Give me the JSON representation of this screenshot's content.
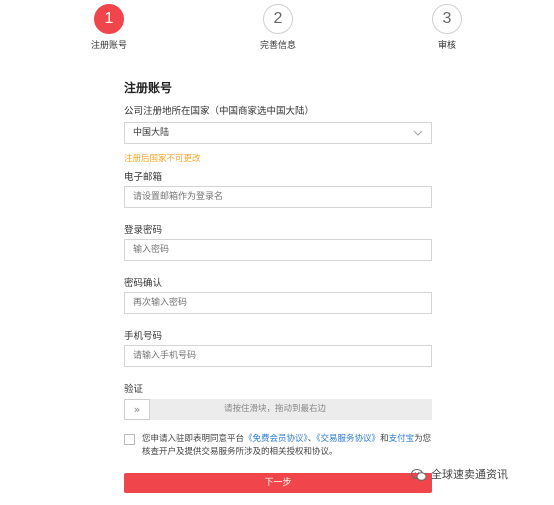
{
  "steps": [
    {
      "number": "1",
      "label": "注册账号"
    },
    {
      "number": "2",
      "label": "完善信息"
    },
    {
      "number": "3",
      "label": "审核"
    }
  ],
  "form": {
    "heading": "注册账号",
    "country_label": "公司注册地所在国家（中国商家选中国大陆）",
    "country_value": "中国大陆",
    "country_note": "注册后国家不可更改",
    "email_label": "电子邮箱",
    "email_placeholder": "请设置邮箱作为登录名",
    "password_label": "登录密码",
    "password_placeholder": "输入密码",
    "confirm_label": "密码确认",
    "confirm_placeholder": "再次输入密码",
    "phone_label": "手机号码",
    "phone_placeholder": "请输入手机号码",
    "verify_label": "验证",
    "slider_handle": "»",
    "slider_text": "请按住滑块，拖动到最右边",
    "agree_prefix": "您申请入驻即表明同意平台",
    "agree_link1": "《免费会员协议》",
    "agree_sep": "、",
    "agree_link2": "《交易服务协议》",
    "agree_and": "和",
    "agree_link3": "支付宝",
    "agree_suffix": "为您核查开户及提供交易服务所涉及的相关授权和协议。",
    "next_button": "下一步"
  },
  "watermark": "全球速卖通资讯",
  "colors": {
    "accent": "#f0464b",
    "note": "#f5a524",
    "link": "#2a7bd4"
  }
}
